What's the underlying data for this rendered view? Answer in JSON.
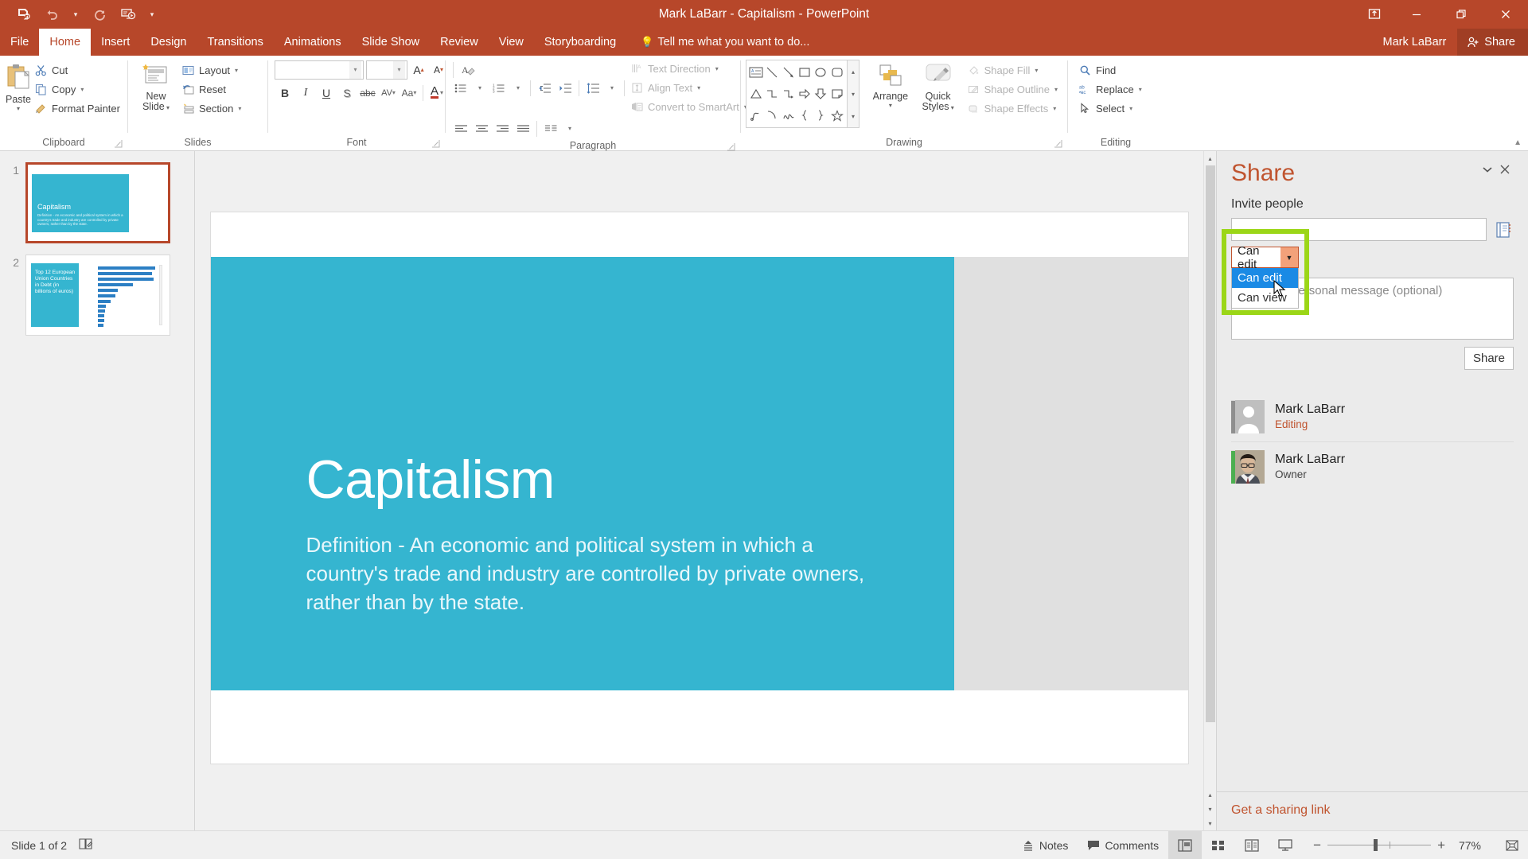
{
  "titlebar": {
    "title": "Mark LaBarr - Capitalism - PowerPoint",
    "qat": [
      {
        "name": "save-icon",
        "label": "Save"
      },
      {
        "name": "undo-icon",
        "label": "Undo"
      },
      {
        "name": "redo-icon",
        "label": "Repeat"
      },
      {
        "name": "start-from-beginning-icon",
        "label": "Start From Beginning"
      },
      {
        "name": "customize-qat-icon",
        "label": "Customize Quick Access Toolbar"
      }
    ],
    "window_controls": [
      {
        "name": "ribbon-display-options",
        "label": "Ribbon Display Options"
      },
      {
        "name": "minimize",
        "label": "Minimize"
      },
      {
        "name": "restore",
        "label": "Restore Down"
      },
      {
        "name": "close",
        "label": "Close"
      }
    ]
  },
  "tabs": [
    {
      "label": "File",
      "active": false
    },
    {
      "label": "Home",
      "active": true
    },
    {
      "label": "Insert",
      "active": false
    },
    {
      "label": "Design",
      "active": false
    },
    {
      "label": "Transitions",
      "active": false
    },
    {
      "label": "Animations",
      "active": false
    },
    {
      "label": "Slide Show",
      "active": false
    },
    {
      "label": "Review",
      "active": false
    },
    {
      "label": "View",
      "active": false
    },
    {
      "label": "Storyboarding",
      "active": false
    }
  ],
  "tellme": "Tell me what you want to do...",
  "account": {
    "name": "Mark LaBarr",
    "share_label": "Share"
  },
  "ribbon": {
    "groups": [
      {
        "label": "Clipboard",
        "dialog_launcher": true
      },
      {
        "label": "Slides",
        "dialog_launcher": false
      },
      {
        "label": "Font",
        "dialog_launcher": true
      },
      {
        "label": "Paragraph",
        "dialog_launcher": true
      },
      {
        "label": "Drawing",
        "dialog_launcher": true
      },
      {
        "label": "Editing",
        "dialog_launcher": false
      }
    ],
    "clipboard": {
      "paste": "Paste",
      "cut": "Cut",
      "copy": "Copy",
      "format_painter": "Format Painter"
    },
    "slides": {
      "new_slide": "New\nSlide",
      "new_slide_line1": "New",
      "new_slide_line2": "Slide",
      "layout": "Layout",
      "reset": "Reset",
      "section": "Section"
    },
    "font": {
      "font_name": "",
      "font_size": "",
      "bold": "B",
      "italic": "I",
      "underline": "U",
      "shadow": "S",
      "strikethrough": "abc",
      "char_spacing": "AV",
      "change_case": "Aa",
      "font_color": "A",
      "increase_size": "A",
      "decrease_size": "A",
      "clear_formatting": "A"
    },
    "paragraph": {
      "text_direction": "Text Direction",
      "align_text": "Align Text",
      "convert_to_smartart": "Convert to SmartArt"
    },
    "drawing": {
      "arrange": "Arrange",
      "quick_styles_line1": "Quick",
      "quick_styles_line2": "Styles",
      "shape_fill": "Shape Fill",
      "shape_outline": "Shape Outline",
      "shape_effects": "Shape Effects"
    },
    "editing": {
      "find": "Find",
      "replace": "Replace",
      "select": "Select"
    }
  },
  "thumbnails": [
    {
      "number": "1",
      "selected": true,
      "title": "Capitalism",
      "body": "Definition - An economic and political system in which a country's trade and industry are controlled by private owners, rather than by the state."
    },
    {
      "number": "2",
      "selected": false,
      "title": "Top 12 European Union Countries in Debt (in billions of euros)"
    }
  ],
  "slide": {
    "title": "Capitalism",
    "body": "Definition - An economic and political system in which a country's trade and industry are controlled by private owners, rather than by the state."
  },
  "share": {
    "title": "Share",
    "collapse_icon": "chevron-down-icon",
    "close_icon": "close-icon",
    "invite_label": "Invite people",
    "invite_value": "",
    "invite_placeholder": "",
    "address_book_icon": "address-book-icon",
    "permission": {
      "selected": "Can edit",
      "options": [
        "Can edit",
        "Can view"
      ],
      "highlighted": "Can edit",
      "open": true
    },
    "message_placeholder": "Include a personal message (optional)",
    "message_value": "",
    "share_button": "Share",
    "people": [
      {
        "name": "Mark LaBarr",
        "role": "Editing",
        "avatar": "generic-avatar",
        "status": "gray"
      },
      {
        "name": "Mark LaBarr",
        "role": "Owner",
        "avatar": "photo-avatar",
        "status": "green"
      }
    ],
    "get_link": "Get a sharing link"
  },
  "statusbar": {
    "slide_count": "Slide 1 of 2",
    "notes": "Notes",
    "comments": "Comments",
    "zoom_level": "77%",
    "views": [
      {
        "name": "normal-view",
        "active": true
      },
      {
        "name": "slide-sorter-view",
        "active": false
      },
      {
        "name": "reading-view",
        "active": false
      },
      {
        "name": "slide-show-view",
        "active": false
      }
    ],
    "fit_to_window": "Fit slide to current window"
  },
  "colors": {
    "accent": "#b7472a",
    "slide_teal": "#35b5d0",
    "highlight_green": "#9bd617",
    "dropdown_blue": "#1a8ae5",
    "status_green": "#4caf50"
  }
}
